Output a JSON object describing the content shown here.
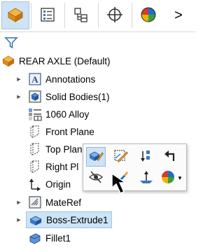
{
  "toolbar": {
    "tabs": [
      {
        "name": "feature-manager-tab-icon",
        "active": true
      },
      {
        "name": "property-manager-tab-icon",
        "active": false
      },
      {
        "name": "configuration-manager-tab-icon",
        "active": false
      },
      {
        "name": "dimxpert-manager-tab-icon",
        "active": false
      },
      {
        "name": "display-manager-tab-icon",
        "active": false
      }
    ],
    "overflow_label": ">"
  },
  "tree": {
    "root": "REAR AXLE (Default)",
    "items": [
      {
        "label": "Annotations",
        "expandable": true,
        "icon": "annotations-icon"
      },
      {
        "label": "Solid Bodies(1)",
        "expandable": true,
        "icon": "solid-bodies-icon"
      },
      {
        "label": "1060 Alloy",
        "expandable": false,
        "icon": "material-icon"
      },
      {
        "label": "Front Plane",
        "expandable": false,
        "icon": "plane-icon"
      },
      {
        "label": "Top Plane",
        "expandable": false,
        "icon": "plane-icon"
      },
      {
        "label": "Right Pl",
        "expandable": false,
        "icon": "plane-icon"
      },
      {
        "label": "Origin",
        "expandable": false,
        "icon": "origin-icon"
      },
      {
        "label": "MateRef",
        "expandable": true,
        "icon": "mate-references-icon"
      },
      {
        "label": "Boss-Extrude1",
        "expandable": true,
        "icon": "extrude-feature-icon",
        "selected": true
      },
      {
        "label": "Fillet1",
        "expandable": false,
        "icon": "fillet-feature-icon"
      }
    ]
  },
  "context_toolbar": {
    "buttons": [
      "edit-feature-icon",
      "edit-sketch-icon",
      "rollback-icon",
      "parent-child-icon",
      "hide-icon",
      "edit-appearance-icon",
      "normal-to-icon",
      "appearance-icon"
    ]
  },
  "colors": {
    "selection": "#cde4f7",
    "accent_orange": "#f0a030",
    "accent_blue": "#1f6fb5"
  }
}
